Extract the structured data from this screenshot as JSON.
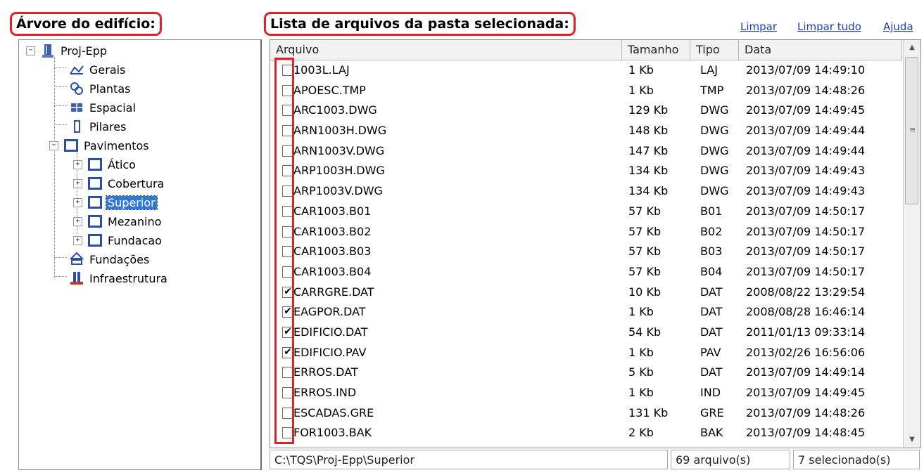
{
  "left_panel": {
    "title": "Árvore do edifício:",
    "tree": {
      "root": "Proj-Epp",
      "children": [
        "Gerais",
        "Plantas",
        "Espacial",
        "Pilares",
        "Pavimentos"
      ],
      "pavimentos": [
        "Ático",
        "Cobertura",
        "Superior",
        "Mezanino",
        "Fundacao"
      ],
      "after": [
        "Fundações",
        "Infraestrutura"
      ],
      "selected": "Superior",
      "expander_collapsed": "+",
      "expander_expanded": "−"
    }
  },
  "right_panel": {
    "title": "Lista de arquivos da pasta selecionada:",
    "links": {
      "clear": "Limpar",
      "clear_all": "Limpar tudo",
      "help": "Ajuda"
    },
    "columns": [
      "Arquivo",
      "Tamanho",
      "Tipo",
      "Data"
    ],
    "files": [
      {
        "name": "1003L.LAJ",
        "size": "1 Kb",
        "type": "LAJ",
        "date": "2013/07/09  14:49:10",
        "checked": false
      },
      {
        "name": "APOESC.TMP",
        "size": "1 Kb",
        "type": "TMP",
        "date": "2013/07/09  14:48:26",
        "checked": false
      },
      {
        "name": "ARC1003.DWG",
        "size": "129 Kb",
        "type": "DWG",
        "date": "2013/07/09  14:49:45",
        "checked": false
      },
      {
        "name": "ARN1003H.DWG",
        "size": "148 Kb",
        "type": "DWG",
        "date": "2013/07/09  14:49:44",
        "checked": false
      },
      {
        "name": "ARN1003V.DWG",
        "size": "147 Kb",
        "type": "DWG",
        "date": "2013/07/09  14:49:44",
        "checked": false
      },
      {
        "name": "ARP1003H.DWG",
        "size": "134 Kb",
        "type": "DWG",
        "date": "2013/07/09  14:49:43",
        "checked": false
      },
      {
        "name": "ARP1003V.DWG",
        "size": "134 Kb",
        "type": "DWG",
        "date": "2013/07/09  14:49:43",
        "checked": false
      },
      {
        "name": "CAR1003.B01",
        "size": "57 Kb",
        "type": "B01",
        "date": "2013/07/09  14:50:17",
        "checked": false
      },
      {
        "name": "CAR1003.B02",
        "size": "57 Kb",
        "type": "B02",
        "date": "2013/07/09  14:50:17",
        "checked": false
      },
      {
        "name": "CAR1003.B03",
        "size": "57 Kb",
        "type": "B03",
        "date": "2013/07/09  14:50:17",
        "checked": false
      },
      {
        "name": "CAR1003.B04",
        "size": "57 Kb",
        "type": "B04",
        "date": "2013/07/09  14:50:17",
        "checked": false
      },
      {
        "name": "CARRGRE.DAT",
        "size": "10 Kb",
        "type": "DAT",
        "date": "2008/08/22  13:29:54",
        "checked": true
      },
      {
        "name": "EAGPOR.DAT",
        "size": "1 Kb",
        "type": "DAT",
        "date": "2008/08/28  16:46:14",
        "checked": true
      },
      {
        "name": "EDIFICIO.DAT",
        "size": "54 Kb",
        "type": "DAT",
        "date": "2011/01/13  09:33:14",
        "checked": true
      },
      {
        "name": "EDIFICIO.PAV",
        "size": "1 Kb",
        "type": "PAV",
        "date": "2013/02/26  16:56:06",
        "checked": true
      },
      {
        "name": "ERROS.DAT",
        "size": "5 Kb",
        "type": "DAT",
        "date": "2013/07/09  14:49:14",
        "checked": false
      },
      {
        "name": "ERROS.IND",
        "size": "1 Kb",
        "type": "IND",
        "date": "2013/07/09  14:49:45",
        "checked": false
      },
      {
        "name": "ESCADAS.GRE",
        "size": "131 Kb",
        "type": "GRE",
        "date": "2013/07/09  14:48:26",
        "checked": false
      },
      {
        "name": "FOR1003.BAK",
        "size": "2 Kb",
        "type": "BAK",
        "date": "2013/07/09  14:48:45",
        "checked": false
      }
    ],
    "check_mark": "✔",
    "scroll": {
      "up": "▲",
      "down": "▼",
      "grip": "≡"
    },
    "status": {
      "path": "C:\\TQS\\Proj-Epp\\Superior",
      "count": "69 arquivo(s)",
      "selected": "7 selecionado(s)"
    }
  }
}
